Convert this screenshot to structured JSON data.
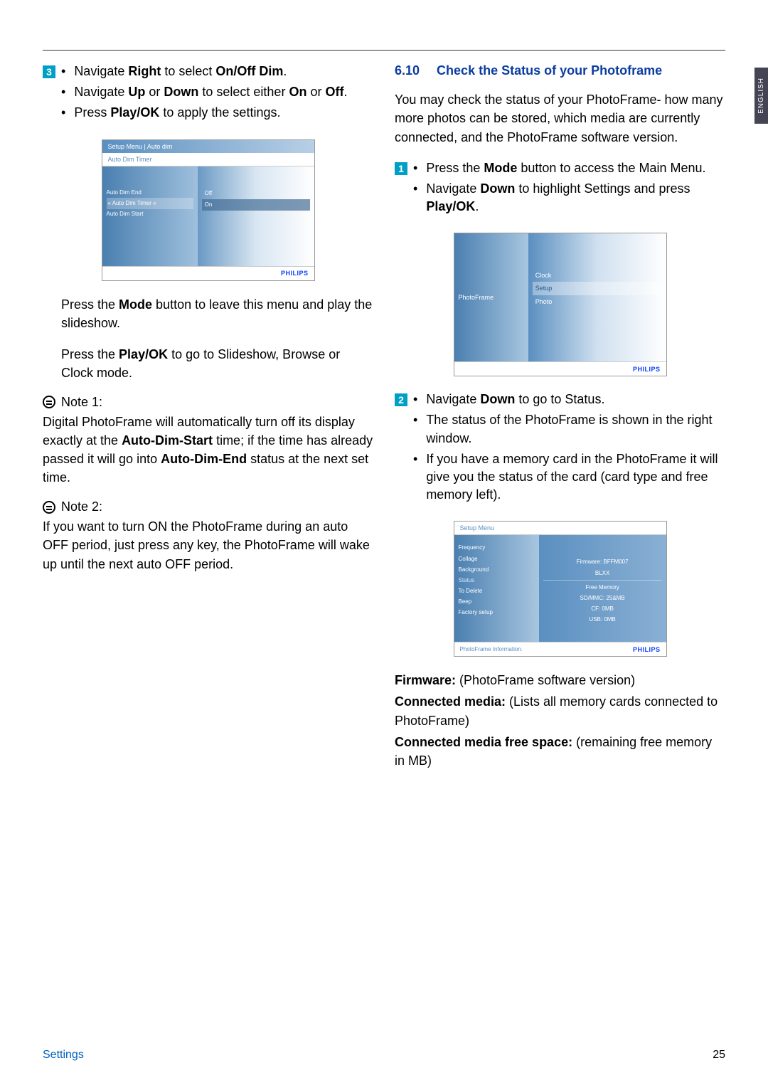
{
  "side_tab": "ENGLISH",
  "left": {
    "step3_num": "3",
    "step3_lines": [
      "Navigate <b>Right</b> to select <b>On/Off Dim</b>.",
      "Navigate <b>Up</b> or <b>Down</b> to select either <b>On</b> or <b>Off</b>.",
      "Press <b>Play/OK</b> to apply the settings."
    ],
    "ss1": {
      "header": "Setup Menu | Auto dim",
      "sub": "Auto Dim Timer",
      "left_items": [
        "Auto Dim End",
        "« Auto Dim Timer »",
        "Auto Dim Start"
      ],
      "left_sel_index": 1,
      "right_items": [
        "Off",
        "On"
      ],
      "right_sel_index": 1,
      "brand": "PHILIPS"
    },
    "after_ss1_p1": "Press the <b>Mode</b> button to leave this menu and play the slideshow.",
    "after_ss1_p2": "Press the <b>Play/OK</b> to go to Slideshow, Browse or Clock mode.",
    "note1_label": "Note 1:",
    "note1_text": "Digital PhotoFrame will automatically turn off its display exactly at the <b>Auto-Dim-Start</b> time; if the time has already passed it will go into <b>Auto-Dim-End</b> status at the next set time.",
    "note2_label": "Note 2:",
    "note2_text": "If you want to turn ON the PhotoFrame during an auto OFF period, just press any key, the PhotoFrame will wake up until the next auto OFF period."
  },
  "right": {
    "section_num": "6.10",
    "section_title": "Check the Status of your Photoframe",
    "intro": "You may check the status of your PhotoFrame- how many more photos can be stored, which media are currently connected, and the PhotoFrame software version.",
    "step1_num": "1",
    "step1_lines": [
      "Press the <b>Mode</b> button to access the Main Menu.",
      "Navigate <b>Down</b> to highlight Settings and press <b>Play/OK</b>."
    ],
    "ss2": {
      "left_label": "PhotoFrame",
      "items": [
        "Clock",
        "Setup",
        "Photo"
      ],
      "sel_index": 1,
      "brand": "PHILIPS"
    },
    "step2_num": "2",
    "step2_lines": [
      "Navigate <b>Down</b> to go to Status.",
      "The status of the PhotoFrame is shown in the right window.",
      "If you have a memory card in the PhotoFrame it will give you the status of the card (card type and free memory left)."
    ],
    "ss3": {
      "header": "Setup Menu",
      "left_items": [
        "Frequency",
        "Collage",
        "Background",
        "Status",
        "To Delete",
        "Beep",
        "Factory setup"
      ],
      "left_sel_index": 3,
      "right_lines_top": [
        "Firmware: BFFM007",
        "BLXX"
      ],
      "right_lines_bottom": [
        "Free Memory",
        "SD/MMC: 25&MB",
        "CF: 0MB",
        "USB: 0MB"
      ],
      "footer": "PhotoFrame Information.",
      "brand": "PHILIPS"
    },
    "defs": [
      "<b>Firmware:</b> (PhotoFrame software version)",
      "<b>Connected media:</b> (Lists all memory cards connected to PhotoFrame)",
      "<b>Connected media free space:</b> (remaining free memory in MB)"
    ]
  },
  "footer_left": "Settings",
  "footer_right": "25"
}
